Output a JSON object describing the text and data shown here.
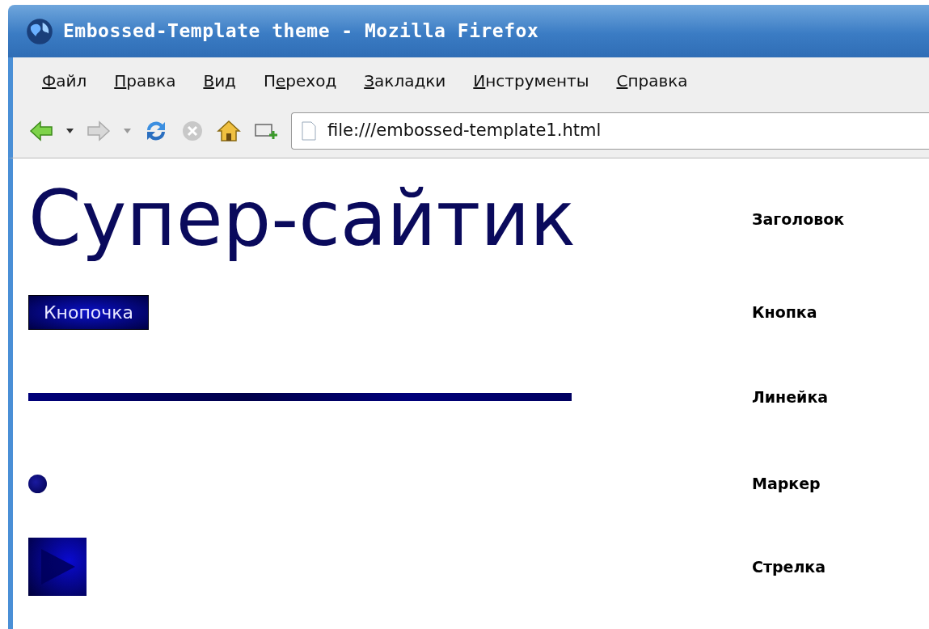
{
  "window": {
    "title": "Embossed-Template theme - Mozilla Firefox"
  },
  "menu": [
    {
      "key": "Ф",
      "after": "айл"
    },
    {
      "key": "П",
      "after": "равка"
    },
    {
      "key": "В",
      "after": "ид"
    },
    {
      "before": "П",
      "key": "е",
      "after": "реход"
    },
    {
      "key": "З",
      "after": "акладки"
    },
    {
      "key": "И",
      "after": "нструменты"
    },
    {
      "key": "С",
      "after": "правка"
    }
  ],
  "toolbar": {
    "url": "file:///embossed-template1.html"
  },
  "rows": [
    {
      "kind": "heading",
      "text": "Супер-сайтик",
      "label": "Заголовок"
    },
    {
      "kind": "button",
      "text": "Кнопочка",
      "label": "Кнопка"
    },
    {
      "kind": "rule",
      "label": "Линейка"
    },
    {
      "kind": "marker",
      "label": "Маркер"
    },
    {
      "kind": "arrow",
      "label": "Стрелка"
    }
  ]
}
